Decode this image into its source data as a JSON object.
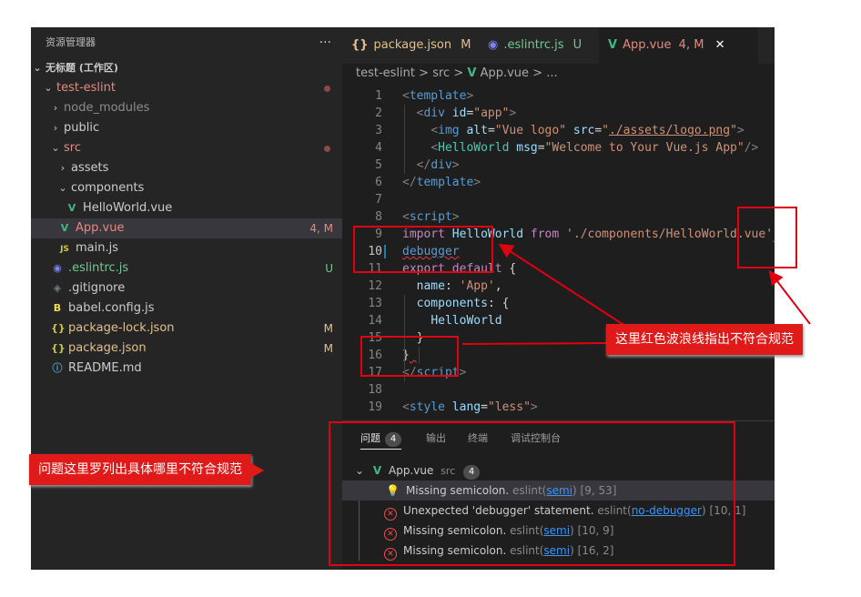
{
  "explorer": {
    "title": "资源管理器",
    "more": "···",
    "workspace": "无标题 (工作区)",
    "items": [
      {
        "name": "test-eslint",
        "type": "folder-open",
        "color": "#e8897d",
        "badge": "dot"
      },
      {
        "name": "node_modules",
        "type": "folder",
        "color": "#8c8c8c"
      },
      {
        "name": "public",
        "type": "folder",
        "color": "#cccccc"
      },
      {
        "name": "src",
        "type": "folder-open",
        "color": "#e8897d",
        "badge": "dot"
      },
      {
        "name": "assets",
        "type": "folder",
        "color": "#cccccc"
      },
      {
        "name": "components",
        "type": "folder-open",
        "color": "#cccccc"
      },
      {
        "name": "HelloWorld.vue",
        "type": "vue",
        "color": "#cccccc"
      },
      {
        "name": "App.vue",
        "type": "vue",
        "color": "#e8897d",
        "badge": "4, M",
        "selected": true
      },
      {
        "name": "main.js",
        "type": "js",
        "color": "#cccccc"
      },
      {
        "name": ".eslintrc.js",
        "type": "eslint",
        "color": "#73c991",
        "badge": "U"
      },
      {
        "name": ".gitignore",
        "type": "git",
        "color": "#cccccc"
      },
      {
        "name": "babel.config.js",
        "type": "babel",
        "color": "#cccccc"
      },
      {
        "name": "package-lock.json",
        "type": "json",
        "color": "#e2c08d",
        "badge": "M"
      },
      {
        "name": "package.json",
        "type": "json",
        "color": "#e2c08d",
        "badge": "M"
      },
      {
        "name": "README.md",
        "type": "info",
        "color": "#cccccc"
      }
    ]
  },
  "tabs": [
    {
      "label": "package.json",
      "status": "M",
      "icon": "json-icon",
      "color": "#e2c08d"
    },
    {
      "label": ".eslintrc.js",
      "status": "U",
      "icon": "eslint-icon",
      "color": "#73c991"
    },
    {
      "label": "App.vue",
      "status": "4, M",
      "icon": "vue-icon",
      "color": "#e8897d",
      "close": "✕",
      "active": true
    }
  ],
  "breadcrumb": {
    "parts": [
      "test-eslint",
      "src",
      "App.vue",
      "..."
    ],
    "sep": ">"
  },
  "code": {
    "line_numbers": [
      "1",
      "2",
      "3",
      "4",
      "5",
      "6",
      "7",
      "8",
      "9",
      "10",
      "11",
      "12",
      "13",
      "14",
      "15",
      "16",
      "17",
      "18",
      "19"
    ],
    "active_line": "10"
  },
  "panel": {
    "tabs": [
      {
        "label": "问题",
        "count": "4",
        "active": true
      },
      {
        "label": "输出"
      },
      {
        "label": "终端"
      },
      {
        "label": "调试控制台"
      }
    ],
    "group": {
      "file": "App.vue",
      "path": "src",
      "count": "4"
    },
    "problems": [
      {
        "severity": "warning",
        "message": "Missing semicolon.",
        "source": "eslint",
        "rule": "semi",
        "location": "[9, 53]"
      },
      {
        "severity": "error",
        "message": "Unexpected 'debugger' statement.",
        "source": "eslint",
        "rule": "no-debugger",
        "location": "[10, 1]"
      },
      {
        "severity": "error",
        "message": "Missing semicolon.",
        "source": "eslint",
        "rule": "semi",
        "location": "[10, 9]"
      },
      {
        "severity": "error",
        "message": "Missing semicolon.",
        "source": "eslint",
        "rule": "semi",
        "location": "[16, 2]"
      }
    ]
  },
  "annotations": {
    "callout_squiggle": "这里红色波浪线指出不符合规范",
    "callout_problems": "问题这里罗列出具体哪里不符合规范"
  },
  "colors": {
    "annotation_red": "#e0000f",
    "vue_green": "#41b883",
    "error_red": "#f14c4c",
    "warning_yellow": "#ffcc00"
  }
}
